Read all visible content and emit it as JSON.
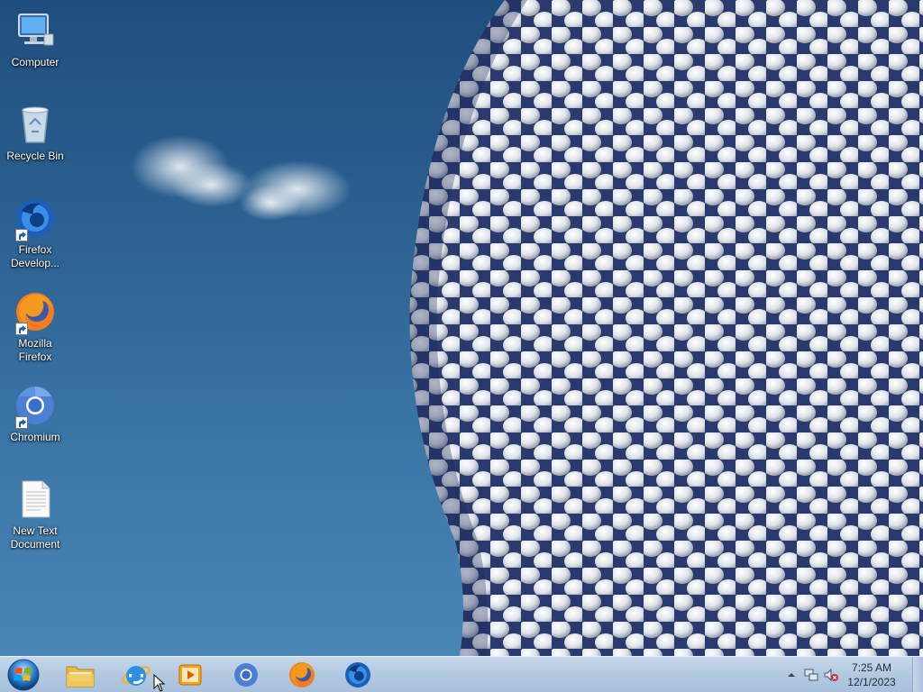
{
  "desktop": {
    "icons": [
      {
        "name": "computer",
        "label": "Computer",
        "icon": "computer-icon",
        "shortcut": false
      },
      {
        "name": "recycle-bin",
        "label": "Recycle Bin",
        "icon": "recycle-bin-icon",
        "shortcut": false
      },
      {
        "name": "firefox-developer",
        "label": "Firefox Develop...",
        "icon": "firefox-developer-icon",
        "shortcut": true
      },
      {
        "name": "mozilla-firefox",
        "label": "Mozilla Firefox",
        "icon": "firefox-icon",
        "shortcut": true
      },
      {
        "name": "chromium",
        "label": "Chromium",
        "icon": "chromium-icon",
        "shortcut": true
      },
      {
        "name": "new-text-document",
        "label": "New Text Document",
        "icon": "text-document-icon",
        "shortcut": false
      }
    ]
  },
  "taskbar": {
    "start_icon": "windows-start-orb-icon",
    "pinned": [
      {
        "name": "windows-explorer",
        "icon": "folder-icon"
      },
      {
        "name": "internet-explorer",
        "icon": "internet-explorer-icon"
      },
      {
        "name": "media-player",
        "icon": "media-player-icon"
      },
      {
        "name": "chromium",
        "icon": "chromium-icon"
      },
      {
        "name": "firefox",
        "icon": "firefox-icon"
      },
      {
        "name": "firefox-developer",
        "icon": "firefox-developer-icon"
      }
    ],
    "tray": {
      "icons": [
        "show-hidden-icons-arrow-icon",
        "network-icon",
        "volume-muted-icon"
      ],
      "time": "7:25 AM",
      "date": "12/1/2023"
    }
  },
  "colors": {
    "sky_top": "#1f4e7d",
    "sky_bottom": "#4a86b5",
    "taskbar": "#b4cae2",
    "label_text": "#ffffff"
  }
}
